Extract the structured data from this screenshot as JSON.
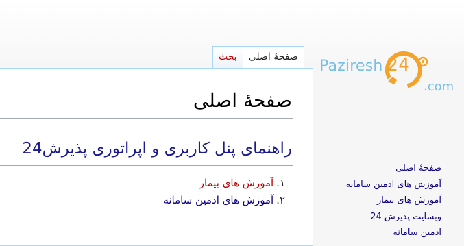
{
  "tabs": {
    "main_page": "صفحهٔ اصلی",
    "talk": "بحث"
  },
  "page": {
    "title": "صفحهٔ اصلی",
    "heading": "راهنمای پنل کاربری و اپراتوری پذیرش24"
  },
  "toc": [
    {
      "number": "۱.",
      "label": "آموزش های بیمار",
      "status": "missing"
    },
    {
      "number": "۲.",
      "label": "آموزش های ادمین سامانه",
      "status": "exists"
    }
  ],
  "logo": {
    "brand": "Paziresh",
    "number": "24",
    "suffix": ".com"
  },
  "sidebar": {
    "items": [
      {
        "label": "صفحهٔ اصلی"
      },
      {
        "label": "آموزش های ادمین سامانه"
      },
      {
        "label": "آموزش های بیمار"
      },
      {
        "label": "وبسایت پذیرش 24"
      },
      {
        "label": "ادمین سامانه"
      }
    ]
  },
  "colors": {
    "link": "#0b0080",
    "missing_link": "#ba0000",
    "tab_border": "#a7d7f9",
    "logo_blue": "#74bfe3",
    "logo_orange": "#f4a32a"
  }
}
